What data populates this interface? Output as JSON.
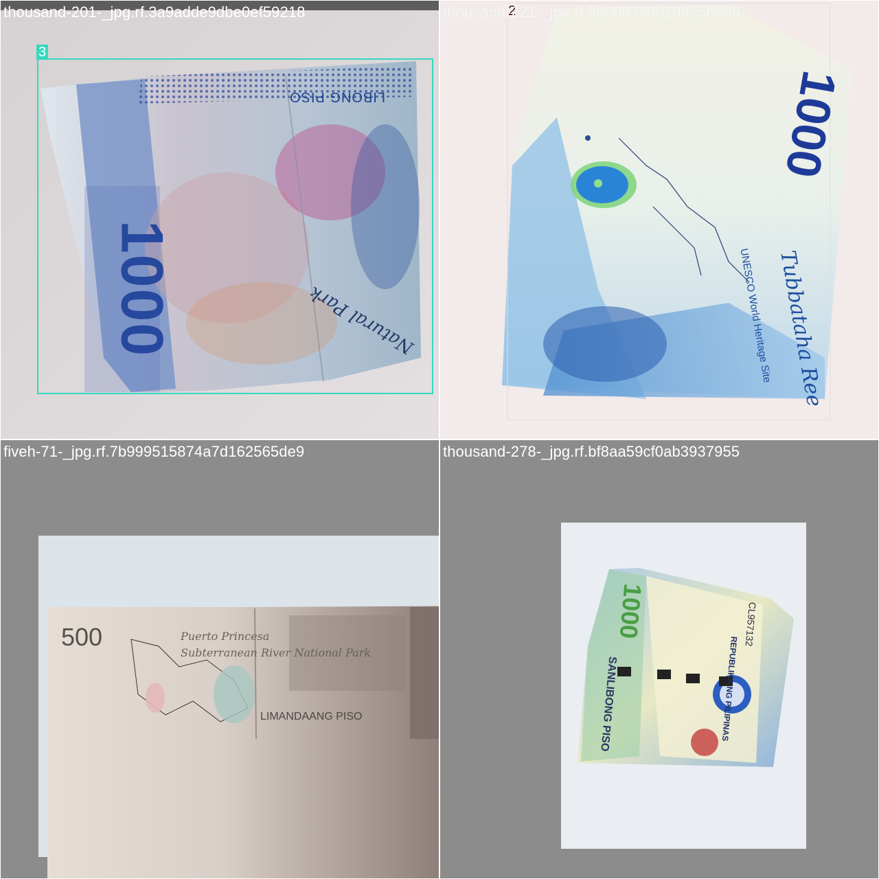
{
  "grid": {
    "tiles": [
      {
        "filename": "thousand-201-_jpg.rf.3a9adde9dbe0ef59218",
        "box_label": "3",
        "note_texts": {
          "denomination": "1000",
          "piso_text": "LIBONG PISO",
          "script_text": "Natural Park"
        }
      },
      {
        "filename": "thousand-221-_jpg.rf.ffa909328b19825b599",
        "box_label": "2",
        "note_texts": {
          "denomination": "1000",
          "site_text": "Tubbataha Ree",
          "unesco": "UNESCO World Heritage Site"
        }
      },
      {
        "filename": "fiveh-71-_jpg.rf.7b999515874a7d162565de9",
        "box_label": "",
        "note_texts": {
          "denomination": "500",
          "place": "Puerto Princesa",
          "river": "Subterranean River National Park",
          "piso_text": "LIMANDAANG PISO"
        }
      },
      {
        "filename": "thousand-278-_jpg.rf.bf8aa59cf0ab3937955",
        "box_label": "",
        "note_texts": {
          "denomination": "1000",
          "piso_text": "SANLIBONG PISO",
          "country": "REPUBLIKA NG PILIPINAS",
          "serial": "CL957132"
        }
      }
    ]
  }
}
